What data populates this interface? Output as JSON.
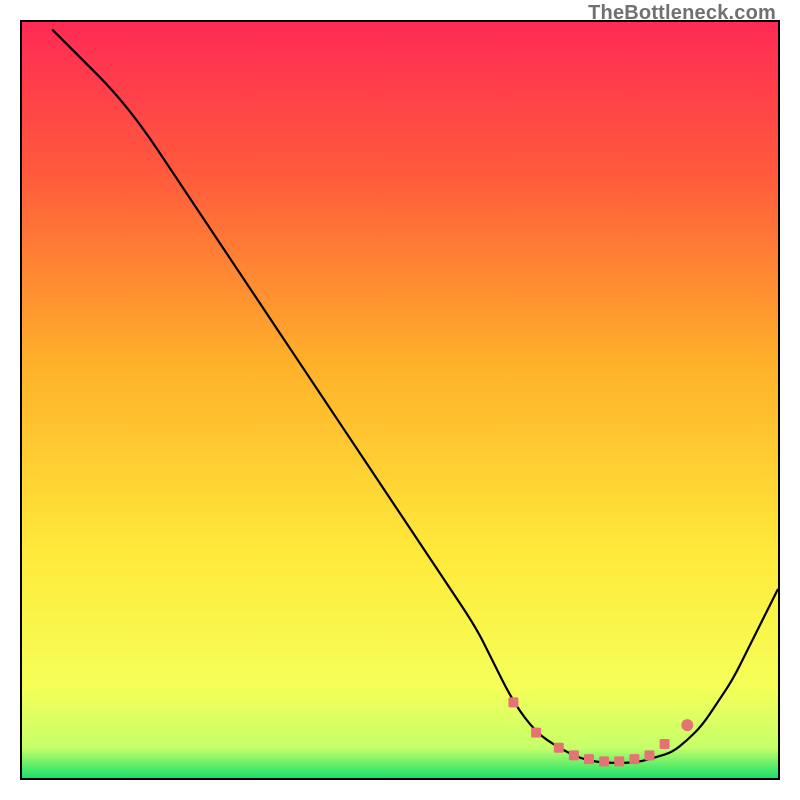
{
  "watermark": "TheBottleneck.com",
  "chart_data": {
    "type": "line",
    "title": "",
    "xlabel": "",
    "ylabel": "",
    "xlim": [
      0,
      100
    ],
    "ylim": [
      0,
      100
    ],
    "gradient_stops": [
      {
        "offset": 0,
        "color": "#ff2a55"
      },
      {
        "offset": 0.2,
        "color": "#ff5a3c"
      },
      {
        "offset": 0.45,
        "color": "#ffb02a"
      },
      {
        "offset": 0.7,
        "color": "#ffe93a"
      },
      {
        "offset": 0.88,
        "color": "#f5ff58"
      },
      {
        "offset": 0.96,
        "color": "#c6ff6a"
      },
      {
        "offset": 1.0,
        "color": "#18e06a"
      }
    ],
    "series": [
      {
        "name": "bottleneck-curve",
        "x": [
          4,
          8,
          12,
          16,
          20,
          24,
          28,
          32,
          36,
          40,
          44,
          48,
          52,
          56,
          60,
          62,
          65,
          68,
          71,
          74,
          77,
          80,
          82,
          84,
          86,
          88,
          90,
          92,
          94,
          96,
          98,
          100
        ],
        "y": [
          99,
          95,
          91,
          86,
          80,
          74,
          68,
          62,
          56,
          50,
          44,
          38,
          32,
          26,
          20,
          16,
          10,
          6,
          4,
          2.5,
          2,
          2,
          2.2,
          2.8,
          3.4,
          5,
          7,
          10,
          13,
          17,
          21,
          25
        ]
      }
    ],
    "markers": {
      "name": "valley-markers",
      "color": "#e57373",
      "points": [
        {
          "x": 65,
          "y": 10,
          "shape": "square"
        },
        {
          "x": 68,
          "y": 6,
          "shape": "square"
        },
        {
          "x": 71,
          "y": 4,
          "shape": "square"
        },
        {
          "x": 73,
          "y": 3,
          "shape": "square"
        },
        {
          "x": 75,
          "y": 2.5,
          "shape": "square"
        },
        {
          "x": 77,
          "y": 2.2,
          "shape": "square"
        },
        {
          "x": 79,
          "y": 2.2,
          "shape": "square"
        },
        {
          "x": 81,
          "y": 2.5,
          "shape": "square"
        },
        {
          "x": 83,
          "y": 3,
          "shape": "square"
        },
        {
          "x": 85,
          "y": 4.5,
          "shape": "square"
        },
        {
          "x": 88,
          "y": 7,
          "shape": "circle"
        }
      ]
    }
  }
}
